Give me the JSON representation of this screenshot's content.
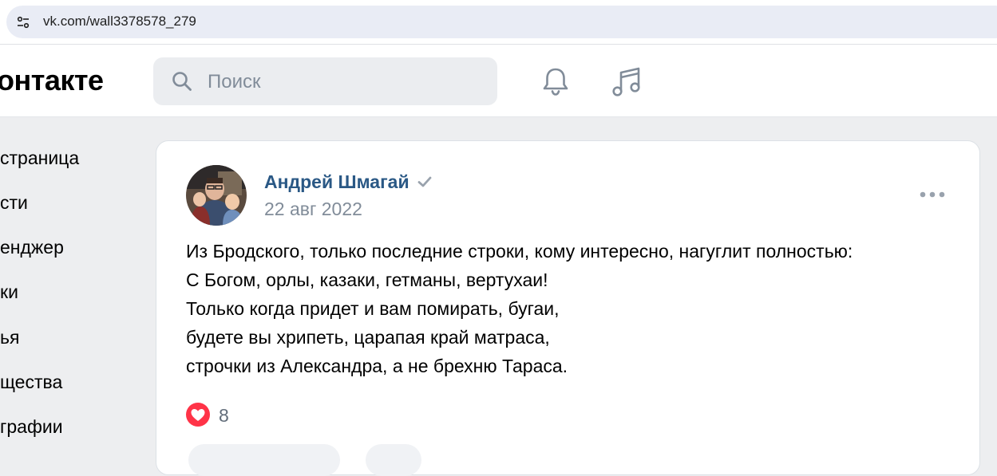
{
  "browser": {
    "url": "vk.com/wall3378578_279"
  },
  "header": {
    "logo_text": "онтакте",
    "search_placeholder": "Поиск",
    "icons": [
      "search-icon",
      "bell-icon",
      "music-icon"
    ]
  },
  "sidebar": {
    "items": [
      {
        "label": "страница"
      },
      {
        "label": "сти"
      },
      {
        "label": "енджер"
      },
      {
        "label": "ки"
      },
      {
        "label": "ья"
      },
      {
        "label": "щества"
      },
      {
        "label": "графии"
      }
    ]
  },
  "post": {
    "author": "Андрей Шмагай",
    "date": "22 авг 2022",
    "lines": [
      "Из Бродского, только последние строки, кому интересно, нагуглит полностью:",
      "С Богом, орлы, казаки, гетманы, вертухаи!",
      "Только когда придет и вам помирать, бугаи,",
      "будете вы хрипеть, царапая край матраса,",
      "строчки из Александра, а не брехню Тараса."
    ],
    "likes": "8"
  },
  "colors": {
    "link": "#2a5885",
    "secondary": "#818c99",
    "like": "#ff3347",
    "background": "#edeef0"
  }
}
